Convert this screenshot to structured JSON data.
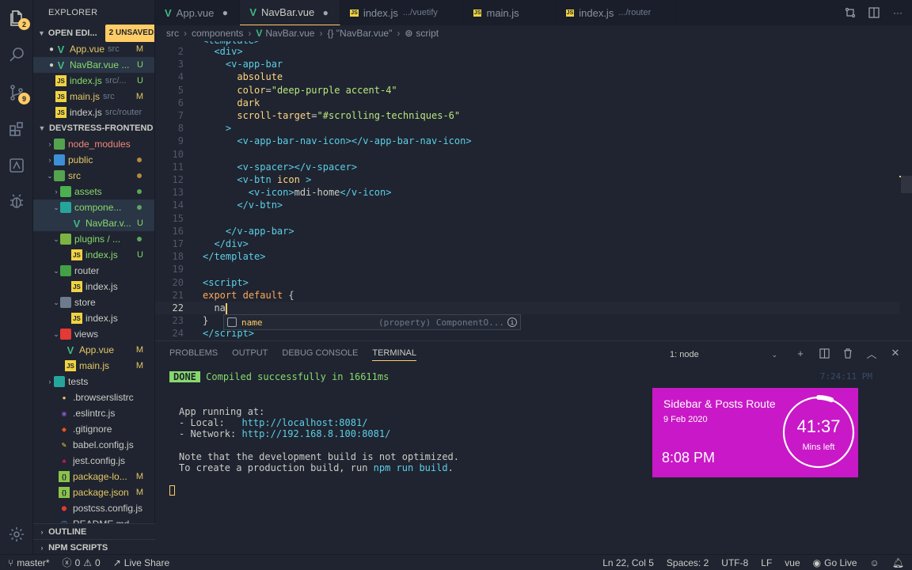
{
  "explorer": {
    "title": "EXPLORER",
    "open_editors_label": "OPEN EDI...",
    "unsaved_badge": "2 UNSAVED",
    "open_editors": [
      {
        "name": "App.vue",
        "path": "src",
        "status": "M",
        "icon": "vue-icon"
      },
      {
        "name": "NavBar.vue ...",
        "path": "",
        "status": "U",
        "icon": "vue-icon"
      },
      {
        "name": "index.js",
        "path": "src/...",
        "status": "U",
        "icon": "js-icon"
      },
      {
        "name": "main.js",
        "path": "src",
        "status": "M",
        "icon": "js-icon"
      },
      {
        "name": "index.js",
        "path": "src/router",
        "status": "",
        "icon": "js-icon"
      }
    ],
    "project_label": "DEVSTRESS-FRONTEND",
    "tree": [
      {
        "name": "node_modules",
        "icon": "folder-icon"
      },
      {
        "name": "public",
        "icon": "folder-icon"
      },
      {
        "name": "src",
        "icon": "folder-icon"
      },
      {
        "name": "assets",
        "icon": "folder-icon"
      },
      {
        "name": "compone...",
        "icon": "folder-icon"
      },
      {
        "name": "NavBar.v...",
        "status": "U",
        "icon": "vue-icon"
      },
      {
        "name": "plugins / ...",
        "icon": "folder-icon"
      },
      {
        "name": "index.js",
        "status": "U",
        "icon": "js-icon"
      },
      {
        "name": "router",
        "icon": "folder-icon"
      },
      {
        "name": "index.js",
        "icon": "js-icon"
      },
      {
        "name": "store",
        "icon": "folder-icon"
      },
      {
        "name": "index.js",
        "icon": "js-icon"
      },
      {
        "name": "views",
        "icon": "folder-icon"
      },
      {
        "name": "App.vue",
        "status": "M",
        "icon": "vue-icon"
      },
      {
        "name": "main.js",
        "status": "M",
        "icon": "js-icon"
      },
      {
        "name": "tests",
        "icon": "folder-icon"
      },
      {
        "name": ".browserslistrc",
        "icon": "file-icon"
      },
      {
        "name": ".eslintrc.js",
        "icon": "eslint-icon"
      },
      {
        "name": ".gitignore",
        "icon": "git-icon"
      },
      {
        "name": "babel.config.js",
        "icon": "babel-icon"
      },
      {
        "name": "jest.config.js",
        "icon": "js-icon"
      },
      {
        "name": "package-lo...",
        "status": "M",
        "icon": "json-icon"
      },
      {
        "name": "package.json",
        "status": "M",
        "icon": "json-icon"
      },
      {
        "name": "postcss.config.js",
        "icon": "postcss-icon"
      },
      {
        "name": "README.md",
        "icon": "markdown-icon"
      }
    ],
    "outline_label": "OUTLINE",
    "npm_scripts_label": "NPM SCRIPTS"
  },
  "activity": {
    "explorer_badge": "2",
    "scm_badge": "9"
  },
  "tabs": [
    {
      "label": "App.vue",
      "path": "",
      "icon": "vue-icon",
      "modified": true
    },
    {
      "label": "NavBar.vue",
      "path": "",
      "icon": "vue-icon",
      "modified": true
    },
    {
      "label": "index.js",
      "path": ".../vuetify",
      "icon": "js-icon",
      "modified": false
    },
    {
      "label": "main.js",
      "path": "",
      "icon": "js-icon",
      "modified": false
    },
    {
      "label": "index.js",
      "path": ".../router",
      "icon": "js-icon",
      "modified": false
    }
  ],
  "breadcrumb": [
    "src",
    "components",
    "NavBar.vue",
    "{} \"NavBar.vue\"",
    "script"
  ],
  "editor": {
    "lines": [
      {
        "n": "2",
        "html": "  <span class='tag'>&lt;div&gt;</span>"
      },
      {
        "n": "3",
        "html": "    <span class='tag'>&lt;v-app-bar</span>"
      },
      {
        "n": "4",
        "html": "      <span class='attr'>absolute</span>"
      },
      {
        "n": "5",
        "html": "      <span class='attr'>color</span><span class='txt'>=</span><span class='str'>\"deep-purple accent-4\"</span>"
      },
      {
        "n": "6",
        "html": "      <span class='attr'>dark</span>"
      },
      {
        "n": "7",
        "html": "      <span class='attr'>scroll-target</span><span class='txt'>=</span><span class='str'>\"#scrolling-techniques-6\"</span>"
      },
      {
        "n": "8",
        "html": "    <span class='tag'>&gt;</span>"
      },
      {
        "n": "9",
        "html": "      <span class='tag'>&lt;v-app-bar-nav-icon&gt;&lt;/v-app-bar-nav-icon&gt;</span>"
      },
      {
        "n": "10",
        "html": ""
      },
      {
        "n": "11",
        "html": "      <span class='tag'>&lt;v-spacer&gt;&lt;/v-spacer&gt;</span>"
      },
      {
        "n": "12",
        "html": "      <span class='tag'>&lt;v-btn</span> <span class='attr'>icon</span> <span class='tag'>&gt;</span>"
      },
      {
        "n": "13",
        "html": "        <span class='tag'>&lt;v-icon&gt;</span><span class='txt'>mdi-home</span><span class='tag'>&lt;/v-icon&gt;</span>"
      },
      {
        "n": "14",
        "html": "      <span class='tag'>&lt;/v-btn&gt;</span>"
      },
      {
        "n": "15",
        "html": ""
      },
      {
        "n": "16",
        "html": "    <span class='tag'>&lt;/v-app-bar&gt;</span>"
      },
      {
        "n": "17",
        "html": "  <span class='tag'>&lt;/div&gt;</span>"
      },
      {
        "n": "18",
        "html": "<span class='tag'>&lt;/template&gt;</span>"
      },
      {
        "n": "19",
        "html": ""
      },
      {
        "n": "20",
        "html": "<span class='tag'>&lt;script&gt;</span>"
      },
      {
        "n": "21",
        "html": "<span class='kw'>export</span> <span class='kw'>default</span> <span class='txt'>{</span>"
      },
      {
        "n": "22",
        "html": "  <span class='txt'>na</span><span class='cursor'></span>"
      },
      {
        "n": "23",
        "html": "<span class='txt'>}</span>"
      },
      {
        "n": "24",
        "html": "<span class='tag'>&lt;/script&gt;</span>"
      }
    ],
    "suggestion": {
      "label": "name",
      "detail": "(property) ComponentO..."
    }
  },
  "panel": {
    "tabs": [
      "PROBLEMS",
      "OUTPUT",
      "DEBUG CONSOLE",
      "TERMINAL"
    ],
    "active_tab": "TERMINAL",
    "terminal_select": "1: node",
    "timestamp": "7:24:11 PM",
    "done_badge": "DONE",
    "compiled_msg": "Compiled successfully in 16611ms",
    "running_at": "App running at:",
    "local_label": "- Local:   ",
    "local_url": "http://localhost:8081/",
    "network_label": "- Network: ",
    "network_url": "http://192.168.8.100:8081/",
    "note1": "Note that the development build is not optimized.",
    "note2_prefix": "To create a production build, run ",
    "note2_cmd": "npm run build",
    "note2_suffix": "."
  },
  "timer": {
    "title": "Sidebar & Posts Route",
    "date": "9 Feb 2020",
    "time": "8:08 PM",
    "minutes": "41:37",
    "label": "Mins left",
    "progress": 0.06
  },
  "status": {
    "branch": "master*",
    "errors": "0",
    "warnings": "0",
    "live_share": "Live Share",
    "position": "Ln 22, Col 5",
    "spaces": "Spaces: 2",
    "encoding": "UTF-8",
    "eol": "LF",
    "language": "vue",
    "go_live": "Go Live"
  },
  "colors": {
    "accent": "#ffcc66",
    "timer_bg": "#c918c7",
    "background": "#1f2430"
  }
}
